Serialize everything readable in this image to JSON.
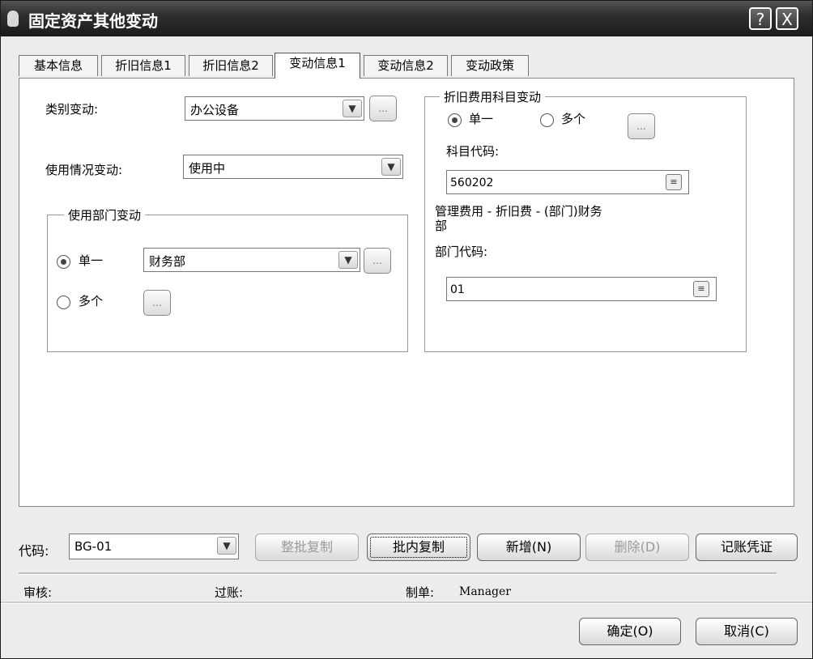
{
  "window": {
    "title": "固定资产其他变动",
    "help_btn": "?",
    "close_btn": "X"
  },
  "tabs": [
    {
      "label": "基本信息"
    },
    {
      "label": "折旧信息1"
    },
    {
      "label": "折旧信息2"
    },
    {
      "label": "变动信息1"
    },
    {
      "label": "变动信息2"
    },
    {
      "label": "变动政策"
    }
  ],
  "active_tab": "变动信息1",
  "left": {
    "category_label": "类别变动:",
    "category_value": "办公设备",
    "usage_label": "使用情况变动:",
    "usage_value": "使用中",
    "dept_group_title": "使用部门变动",
    "single_label": "单一",
    "multi_label": "多个",
    "dept_value": "财务部"
  },
  "right": {
    "group_title": "折旧费用科目变动",
    "single_label": "单一",
    "multi_label": "多个",
    "account_code_label": "科目代码:",
    "account_code_value": "560202",
    "account_desc_line1": "管理费用 - 折旧费 - (部门)财务",
    "account_desc_line2": "部",
    "dept_code_label": "部门代码:",
    "dept_code_value": "01"
  },
  "toolbar": {
    "code_label": "代码:",
    "code_value": "BG-01",
    "batch_copy": "整批复制",
    "inbatch_copy": "批内复制",
    "add": "新增(N)",
    "delete": "删除(D)",
    "voucher": "记账凭证"
  },
  "status": {
    "review_label": "审核:",
    "post_label": "过账:",
    "maker_label": "制单:",
    "maker_value": "Manager"
  },
  "footer": {
    "ok": "确定(O)",
    "cancel": "取消(C)"
  },
  "ellipsis": "...",
  "arrow_glyph": "▼",
  "picker_glyph": "≡"
}
